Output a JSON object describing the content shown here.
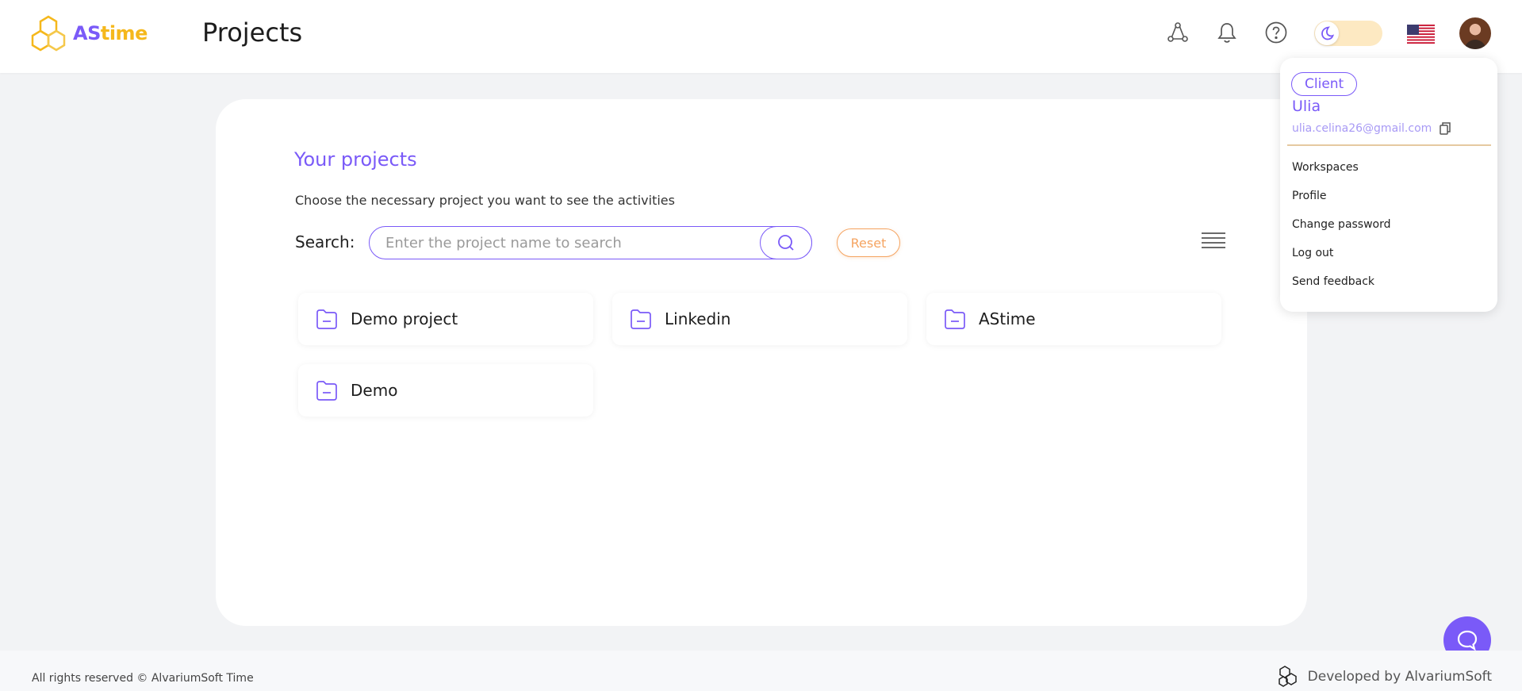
{
  "app": {
    "logo_as": "AS",
    "logo_time": "time",
    "page_title": "Projects"
  },
  "header": {
    "icons": [
      "integrations-icon",
      "bell-icon",
      "help-icon",
      "moon-icon",
      "us-flag-icon",
      "avatar"
    ]
  },
  "main": {
    "title": "Your projects",
    "subtitle": "Choose the necessary project you want to see the activities",
    "search_label": "Search:",
    "search_placeholder": "Enter the project name to search",
    "search_value": "",
    "reset_label": "Reset",
    "projects": [
      {
        "name": "Demo project"
      },
      {
        "name": "Linkedin"
      },
      {
        "name": "AStime"
      },
      {
        "name": "Demo"
      }
    ]
  },
  "user_menu": {
    "role": "Client",
    "name": "Ulia",
    "email": "ulia.celina26@gmail.com",
    "items": [
      "Workspaces",
      "Profile",
      "Change password",
      "Log out",
      "Send feedback"
    ]
  },
  "footer": {
    "copyright": "All rights reserved © AlvariumSoft Time",
    "developer": "Developed by AlvariumSoft"
  },
  "colors": {
    "accent": "#7a5af8",
    "brand_yellow": "#f5b81c",
    "reset_orange": "#f5a461",
    "background": "#f2f3f5"
  }
}
